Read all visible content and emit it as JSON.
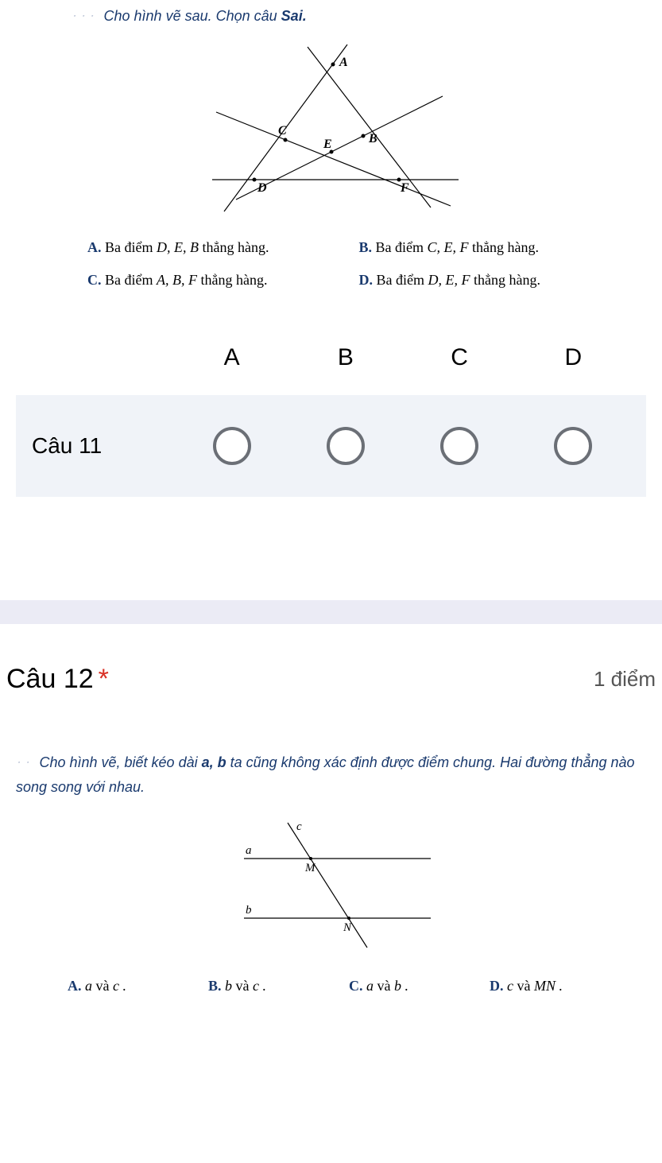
{
  "q11": {
    "prompt_lead": "Cho hình vẽ sau. Chọn câu ",
    "prompt_bold": "Sai.",
    "labels": {
      "A": "A",
      "B": "B",
      "C": "C",
      "D": "D",
      "E": "E",
      "F": "F"
    },
    "options": {
      "A": {
        "letter": "A.",
        "pre": " Ba điểm ",
        "math": "D, E, B",
        "post": " thẳng hàng."
      },
      "B": {
        "letter": "B.",
        "pre": " Ba điểm ",
        "math": "C, E, F",
        "post": " thẳng hàng."
      },
      "C": {
        "letter": "C.",
        "pre": " Ba điểm ",
        "math": "A, B, F",
        "post": " thẳng hàng."
      },
      "D": {
        "letter": "D.",
        "pre": " Ba điểm ",
        "math": "D, E, F",
        "post": " thẳng hàng."
      }
    },
    "header": {
      "A": "A",
      "B": "B",
      "C": "C",
      "D": "D"
    },
    "row_label": "Câu 11"
  },
  "q12": {
    "title": "Câu 12",
    "star": "*",
    "points": "1 điểm",
    "prompt_pre": "Cho hình vẽ, biết kéo dài ",
    "prompt_bold": "a, b",
    "prompt_post": " ta cũng không xác định được điểm chung. Hai đường thẳng nào song song với nhau.",
    "labels": {
      "a": "a",
      "b": "b",
      "c": "c",
      "M": "M",
      "N": "N"
    },
    "options": {
      "A": {
        "letter": "A.",
        "math": " a ",
        "conj": "và",
        "math2": " c ."
      },
      "B": {
        "letter": "B.",
        "math": " b ",
        "conj": "và",
        "math2": " c ."
      },
      "C": {
        "letter": "C.",
        "math": " a ",
        "conj": "và",
        "math2": " b ."
      },
      "D": {
        "letter": "D.",
        "math": " c ",
        "conj": "và",
        "math2": " MN ."
      }
    }
  }
}
